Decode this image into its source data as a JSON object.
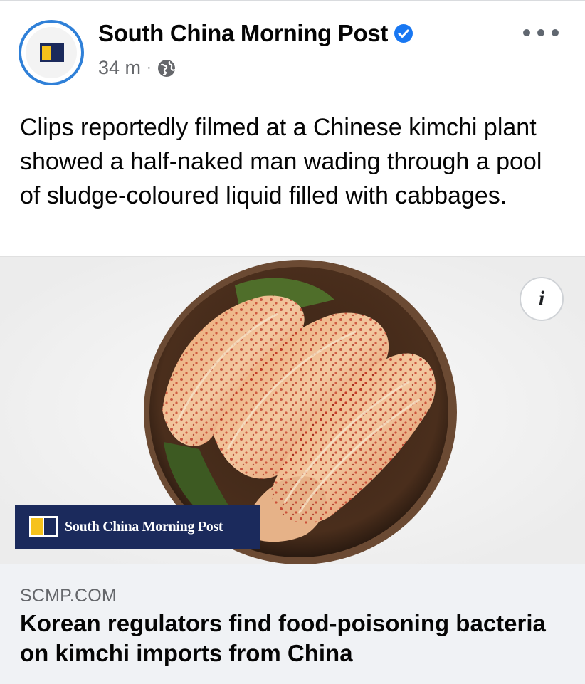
{
  "post": {
    "page_name": "South China Morning Post",
    "verified": true,
    "time": "34 m",
    "separator": "·",
    "audience_icon": "globe-icon",
    "more_icon": "more-horizontal-icon",
    "text": "Clips reportedly filmed at a Chinese kimchi plant showed a half-naked man wading through a pool of sludge-coloured liquid filled with cabbages."
  },
  "media": {
    "info_label": "i",
    "watermark_text": "South China Morning Post"
  },
  "link_preview": {
    "domain": "SCMP.COM",
    "headline": "Korean regulators find food-poisoning bacteria on kimchi imports from China"
  },
  "colors": {
    "verified_blue": "#1877f2",
    "brand_navy": "#1b2a5c",
    "brand_yellow": "#f6c21c",
    "avatar_ring": "#2f80d8",
    "secondary_text": "#65676b",
    "preview_bg": "#f0f2f5"
  }
}
